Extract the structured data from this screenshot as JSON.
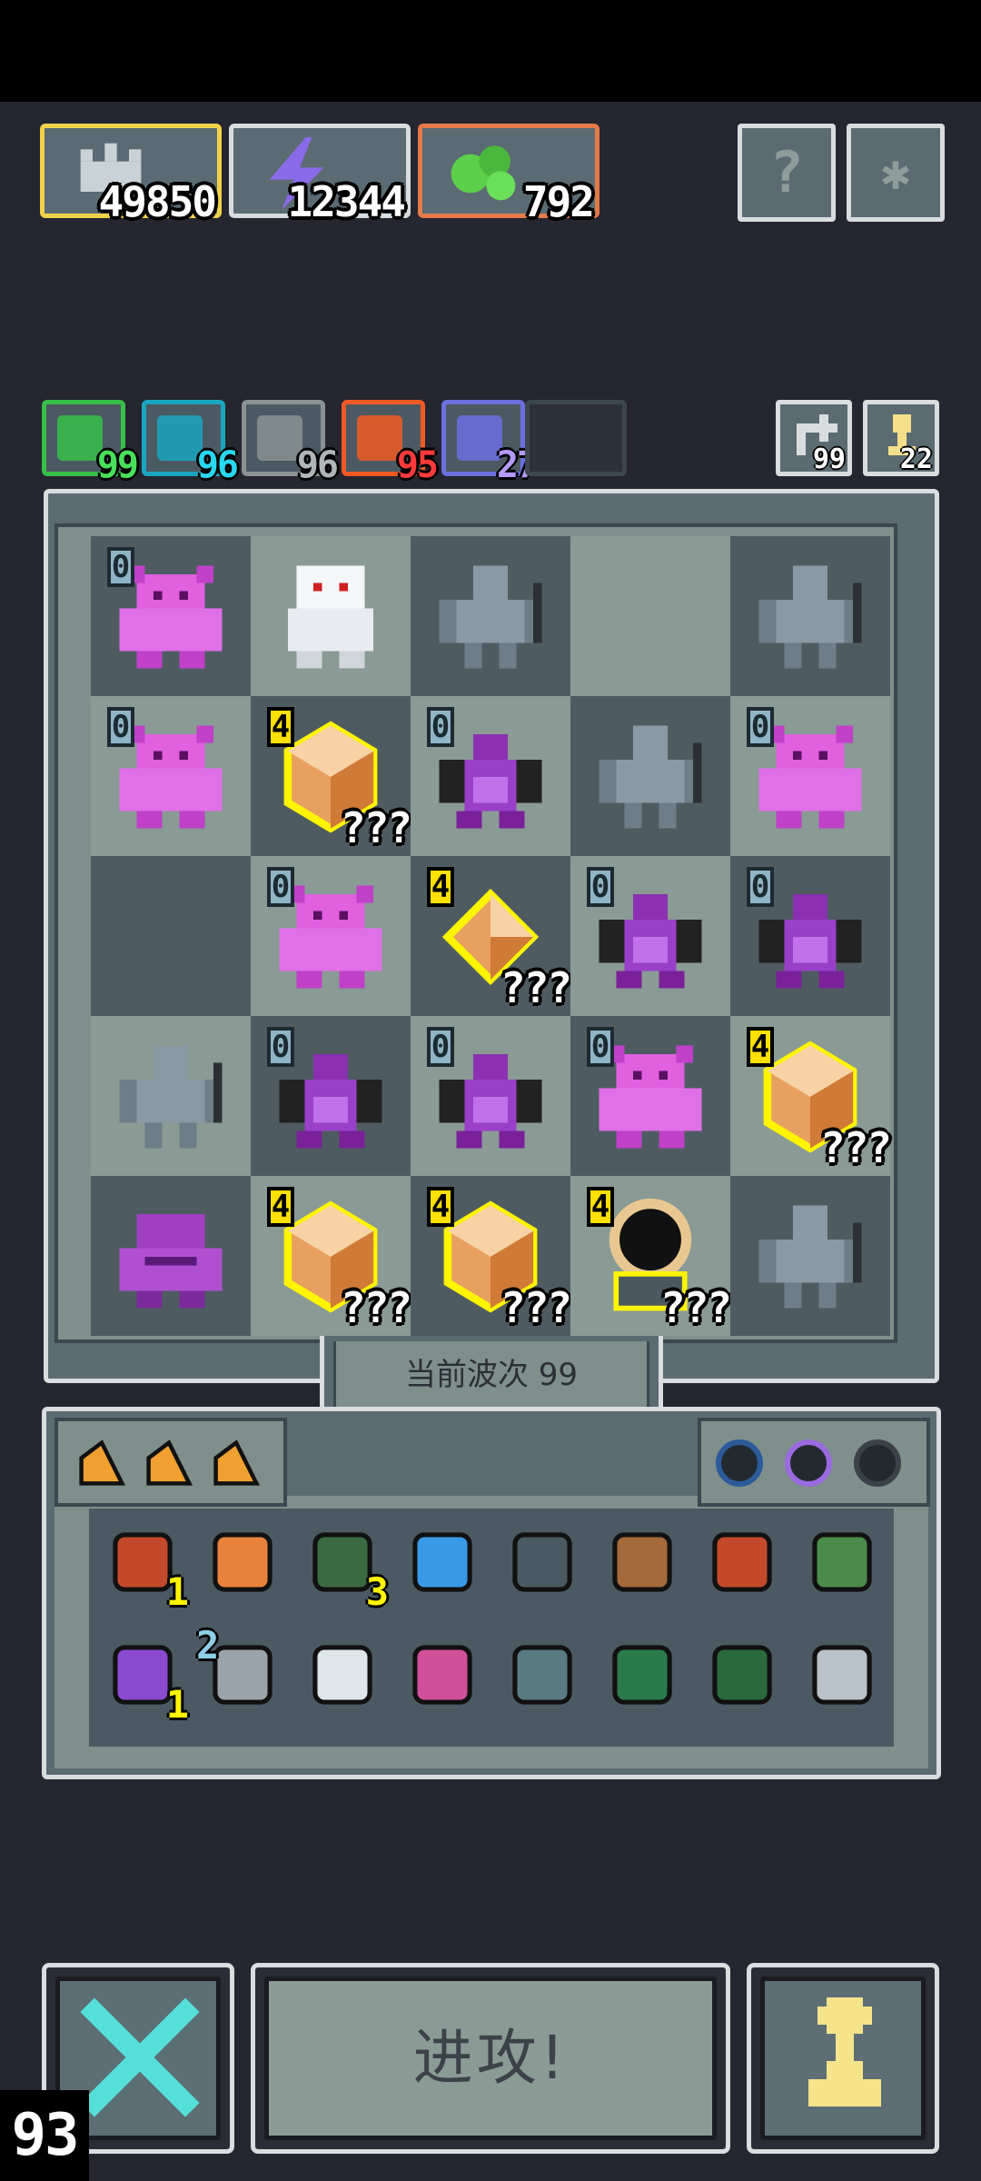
{
  "currencies": [
    {
      "name": "crown-icon",
      "value": "49850",
      "border": "#f0d24a"
    },
    {
      "name": "lightning-icon",
      "value": "12344",
      "border": "#d9dde0"
    },
    {
      "name": "slime-icon",
      "value": "792",
      "border": "#e67a4a"
    }
  ],
  "top_buttons": [
    {
      "name": "help-icon",
      "glyph": "?"
    },
    {
      "name": "settings-icon",
      "glyph": "✱"
    }
  ],
  "buffs": [
    {
      "name": "green-buff",
      "value": "99",
      "color": "#36c04a",
      "text_color": "#48e05a"
    },
    {
      "name": "cyan-buff",
      "value": "96",
      "color": "#1aa6c0",
      "text_color": "#28d8f0"
    },
    {
      "name": "gray-buff",
      "value": "96",
      "color": "#8a9294",
      "text_color": "#b0b6b8"
    },
    {
      "name": "orange-buff",
      "value": "95",
      "color": "#f05a24",
      "text_color": "#ff3a3a"
    },
    {
      "name": "purple-buff",
      "value": "27",
      "color": "#6a70e0",
      "text_color": "#b49aff"
    }
  ],
  "side_buttons": [
    {
      "name": "refresh-icon",
      "value": "99"
    },
    {
      "name": "chess-piece-icon",
      "value": "22"
    }
  ],
  "board": {
    "cells": [
      {
        "shade": "dark",
        "type": "demon",
        "level": "0"
      },
      {
        "shade": "light",
        "type": "ghost",
        "level": ""
      },
      {
        "shade": "dark",
        "type": "golem",
        "level": ""
      },
      {
        "shade": "light",
        "type": "empty",
        "level": ""
      },
      {
        "shade": "dark",
        "type": "golem",
        "level": ""
      },
      {
        "shade": "light",
        "type": "demon",
        "level": "0"
      },
      {
        "shade": "dark",
        "type": "crystal",
        "level": "4",
        "unknown": "???"
      },
      {
        "shade": "light",
        "type": "dragon",
        "level": "0"
      },
      {
        "shade": "dark",
        "type": "golem",
        "level": ""
      },
      {
        "shade": "light",
        "type": "demon",
        "level": "0"
      },
      {
        "shade": "dark",
        "type": "empty",
        "level": ""
      },
      {
        "shade": "light",
        "type": "demon",
        "level": "0"
      },
      {
        "shade": "dark",
        "type": "gem",
        "level": "4",
        "unknown": "???"
      },
      {
        "shade": "light",
        "type": "dragon",
        "level": "0"
      },
      {
        "shade": "dark",
        "type": "dragon",
        "level": "0"
      },
      {
        "shade": "light",
        "type": "golem",
        "level": ""
      },
      {
        "shade": "dark",
        "type": "dragon",
        "level": "0"
      },
      {
        "shade": "light",
        "type": "dragon",
        "level": "0"
      },
      {
        "shade": "dark",
        "type": "demon",
        "level": "0"
      },
      {
        "shade": "light",
        "type": "crystal",
        "level": "4",
        "unknown": "???"
      },
      {
        "shade": "dark",
        "type": "dark-demon",
        "level": ""
      },
      {
        "shade": "light",
        "type": "crystal",
        "level": "4",
        "unknown": "???"
      },
      {
        "shade": "dark",
        "type": "crystal",
        "level": "4",
        "unknown": "???"
      },
      {
        "shade": "light",
        "type": "portal",
        "level": "4",
        "unknown": "???"
      },
      {
        "shade": "dark",
        "type": "golem",
        "level": ""
      }
    ]
  },
  "wave_label": "当前波次 99",
  "inventory": {
    "tabs": [
      "triangle-tab-1",
      "triangle-tab-2",
      "triangle-tab-3"
    ],
    "orbs": [
      {
        "name": "blue-ring-icon",
        "color": "#2c5a9a"
      },
      {
        "name": "purple-ring-icon",
        "color": "#9b6ae0"
      },
      {
        "name": "dark-ring-icon",
        "color": "#3a4248"
      }
    ],
    "items": [
      {
        "name": "bucket-icon",
        "count": "1",
        "pos": "br",
        "color": "#c24a2a"
      },
      {
        "name": "armor-icon",
        "count": "",
        "pos": "br",
        "color": "#e8823c"
      },
      {
        "name": "goblin-icon",
        "count": "3",
        "pos": "br",
        "color": "#3c6a40"
      },
      {
        "name": "crystal-ball-icon",
        "count": "",
        "pos": "br",
        "color": "#3a9ae8"
      },
      {
        "name": "spikes-icon",
        "count": "",
        "pos": "br",
        "color": "#4a5a62"
      },
      {
        "name": "dagger-icon",
        "count": "",
        "pos": "br",
        "color": "#a46a3a"
      },
      {
        "name": "chest-icon",
        "count": "",
        "pos": "br",
        "color": "#c24a2a"
      },
      {
        "name": "arrow-icon",
        "count": "",
        "pos": "br",
        "color": "#4a8a4a"
      },
      {
        "name": "potion-icon",
        "count": "1",
        "pos": "br",
        "color": "#8a4ad0"
      },
      {
        "name": "wall-icon",
        "count": "2",
        "pos": "tl",
        "color": "#9aa4aa"
      },
      {
        "name": "egg-icon",
        "count": "",
        "pos": "br",
        "color": "#dfe6ea"
      },
      {
        "name": "pink-arrow-icon",
        "count": "",
        "pos": "br",
        "color": "#d0509a"
      },
      {
        "name": "lever-icon",
        "count": "",
        "pos": "br",
        "color": "#5a7a84"
      },
      {
        "name": "rune-green-icon",
        "count": "",
        "pos": "br",
        "color": "#2a7a4a"
      },
      {
        "name": "rune-red-icon",
        "count": "",
        "pos": "br",
        "color": "#2a6a3a"
      },
      {
        "name": "claw-icon",
        "count": "",
        "pos": "br",
        "color": "#b8c2c8"
      }
    ]
  },
  "buttons": {
    "cancel": "cancel-x-icon",
    "attack": "进攻!",
    "hero": "pawn-icon"
  },
  "counter": "93"
}
